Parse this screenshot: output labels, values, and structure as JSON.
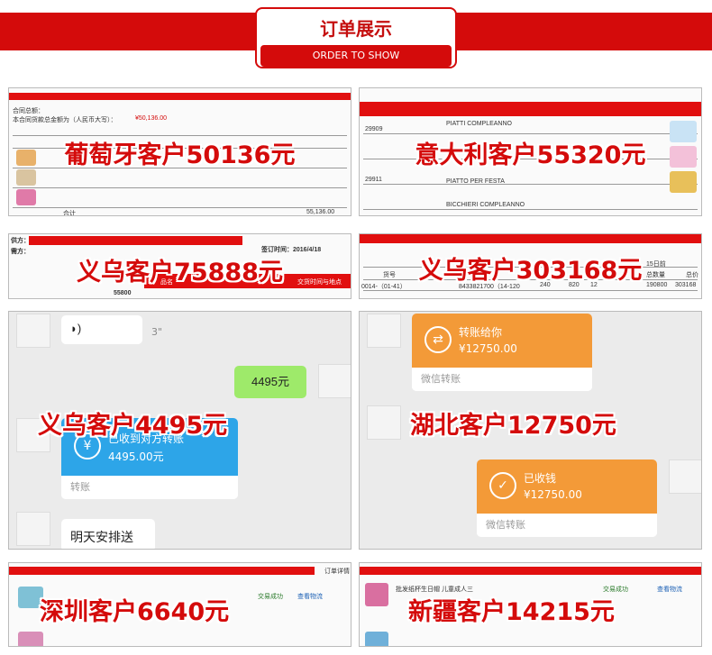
{
  "header": {
    "title": "订单展示",
    "subtitle": "ORDER TO SHOW"
  },
  "tiles": {
    "portugal": {
      "caption": "葡萄牙客户50136元",
      "doc_lines": [
        "合同总额：",
        "本合同货款总金额为（人民币大写）：",
        "¥50,136.00",
        "合计",
        "55,136.00"
      ]
    },
    "italy": {
      "caption": "意大利客户55320元",
      "doc_lines": [
        "29909",
        "29911",
        "PIATTI COMPLEANNO",
        "PIATTO PER FESTA",
        "BICCHIERI COMPLEANNO"
      ]
    },
    "yiwu1": {
      "caption": "义乌客户75888元",
      "doc_lines": [
        "供方：",
        "需方：",
        "签订时间：2016/4/18",
        "品名",
        "交货时间与地点",
        "55800"
      ]
    },
    "yiwu2": {
      "caption": "义乌客户303168元",
      "doc_lines": [
        "货号",
        "15日前",
        "总数量",
        "总价",
        "0014-（01-41）",
        "8433821700（14-120",
        "240",
        "820",
        "12",
        "190800",
        "303168"
      ]
    },
    "yiwu3": {
      "caption": "义乌客户4495元",
      "voice_duration": "3\"",
      "message": "4495元",
      "transfer_status": "已收到对方转账",
      "transfer_amount": "4495.00元",
      "transfer_footer": "转账",
      "last_message": "明天安排送"
    },
    "hubei": {
      "caption": "湖北客户12750元",
      "transfer1_label": "转账给你",
      "transfer1_amount": "¥12750.00",
      "transfer1_footer": "微信转账",
      "transfer2_label": "已收钱",
      "transfer2_amount": "¥12750.00",
      "transfer2_footer": "微信转账"
    },
    "shenzhen": {
      "caption": "深圳客户6640元",
      "doc_lines": [
        "订单详情",
        "交易成功",
        "查看物流"
      ]
    },
    "xinjiang": {
      "caption": "新疆客户14215元",
      "doc_lines": [
        "批发纸杯生日帽 儿童成人三",
        "交易成功",
        "查看物流"
      ]
    }
  },
  "colors": {
    "brand_red": "#d40b0b",
    "wechat_orange": "#f39a38",
    "alipay_blue": "#2da5e8",
    "chat_green": "#9eea6a"
  }
}
